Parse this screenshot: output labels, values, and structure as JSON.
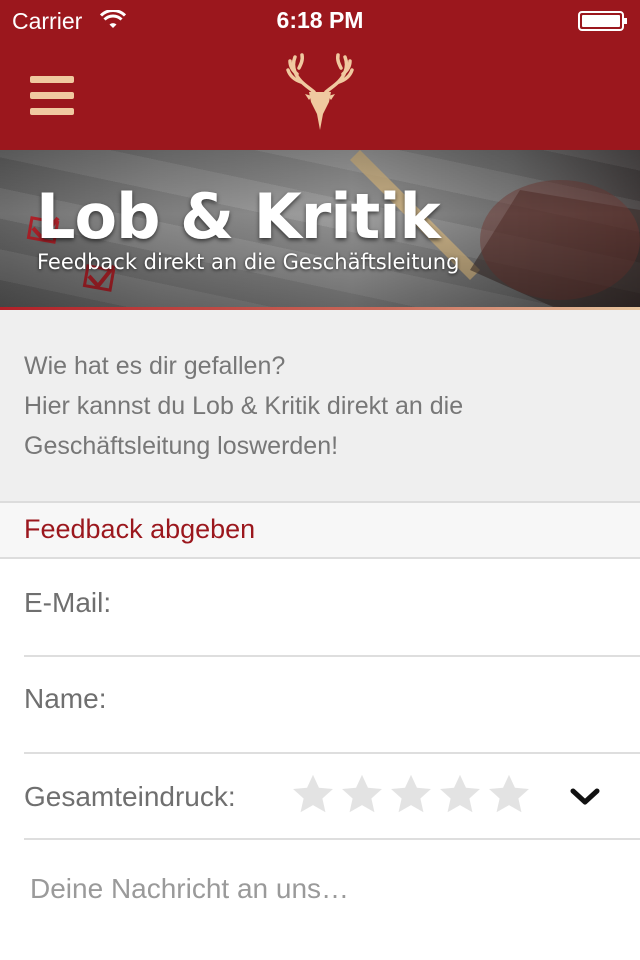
{
  "status_bar": {
    "carrier": "Carrier",
    "time": "6:18 PM"
  },
  "nav": {
    "menu_icon": "hamburger-menu-icon",
    "logo_icon": "deer-antler-logo"
  },
  "hero": {
    "title": "Lob & Kritik",
    "subtitle": "Feedback direkt an die Geschäftsleitung"
  },
  "intro": {
    "lines": [
      "Wie hat es dir gefallen?",
      "Hier kannst du Lob & Kritik direkt an die",
      "Geschäftsleitung loswerden!"
    ]
  },
  "form": {
    "section_title": "Feedback abgeben",
    "email_label": "E-Mail:",
    "name_label": "Name:",
    "rating_label": "Gesamteindruck:",
    "rating": {
      "value": 0,
      "max": 5,
      "dropdown_icon": "chevron-down-icon"
    },
    "message_placeholder": "Deine Nachricht an uns…"
  },
  "colors": {
    "brand_red": "#9b171d",
    "accent_tan": "#f0c9a0",
    "star_empty": "#e3e3e3"
  }
}
